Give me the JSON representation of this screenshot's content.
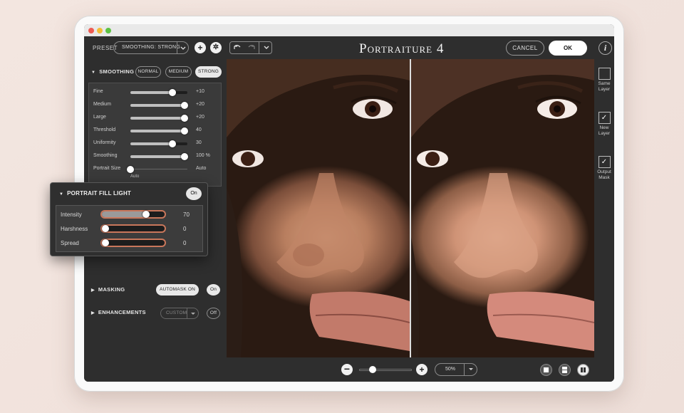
{
  "window": {
    "title": "Portraiture 4"
  },
  "toolbar": {
    "preset_label": "PRESET",
    "preset_value": "SMOOTHING: STRONG",
    "add_icon": "plus-icon",
    "settings_icon": "gear-icon",
    "undo_icon": "undo-icon",
    "redo_icon": "redo-icon",
    "history_icon": "chevron-down-icon",
    "cancel_label": "CANCEL",
    "ok_label": "OK",
    "info_icon": "info-icon"
  },
  "smoothing": {
    "title": "SMOOTHING",
    "modes": [
      "NORMAL",
      "MEDIUM",
      "STRONG"
    ],
    "active_mode": "STRONG",
    "sliders": [
      {
        "label": "Fine",
        "value": "+10",
        "level": 0.74
      },
      {
        "label": "Medium",
        "value": "+20",
        "level": 0.95
      },
      {
        "label": "Large",
        "value": "+20",
        "level": 0.95
      },
      {
        "label": "Threshold",
        "value": "40",
        "level": 0.95
      },
      {
        "label": "Uniformity",
        "value": "30",
        "level": 0.74
      },
      {
        "label": "Smoothing",
        "value": "100 %",
        "level": 0.95
      },
      {
        "label": "Portrait Size",
        "value": "Auto",
        "level": 0.0
      }
    ],
    "portrait_size_sub": "Auto"
  },
  "portrait_fill_light": {
    "title": "PORTRAIT FILL LIGHT",
    "toggle_label": "On",
    "sliders": [
      {
        "label": "Intensity",
        "value": "70",
        "level": 0.7
      },
      {
        "label": "Harshness",
        "value": "0",
        "level": 0.0
      },
      {
        "label": "Spread",
        "value": "0",
        "level": 0.0
      }
    ]
  },
  "masking": {
    "title": "MASKING",
    "automask_label": "AUTOMASK ON",
    "toggle_label": "On"
  },
  "enhancements": {
    "title": "ENHANCEMENTS",
    "select_value": "CUSTOM",
    "toggle_label": "Off"
  },
  "right_rail": [
    {
      "label_1": "Same",
      "label_2": "Layer",
      "checked": false
    },
    {
      "label_1": "New",
      "label_2": "Layer",
      "checked": true
    },
    {
      "label_1": "Output",
      "label_2": "Mask",
      "checked": true
    }
  ],
  "bottom": {
    "zoom_out_icon": "minus-icon",
    "zoom_in_icon": "plus-icon",
    "zoom_level": "50%",
    "zoom_slider_level": 0.25,
    "view_modes": [
      "single-view-icon",
      "split-horizontal-icon",
      "split-vertical-icon"
    ],
    "active_view": "split-vertical-icon"
  },
  "colors": {
    "panel_bg": "#2e2e2e",
    "accent_outline": "#c9775b",
    "ok_bg": "#ffffff"
  }
}
